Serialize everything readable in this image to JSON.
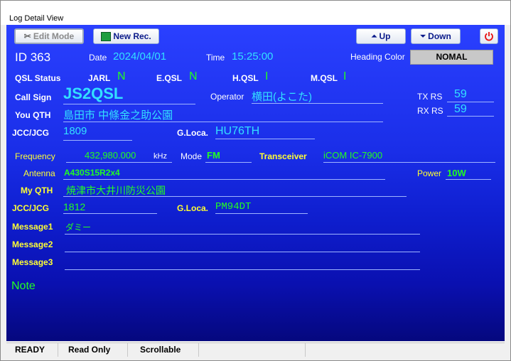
{
  "window": {
    "title": "Log Detail View"
  },
  "toolbar": {
    "edit_mode": "Edit Mode",
    "new_rec": "New Rec.",
    "up": "Up",
    "down": "Down"
  },
  "record": {
    "id": "ID 363",
    "date_label": "Date",
    "date": "2024/04/01",
    "time_label": "Time",
    "time": "15:25:00",
    "heading_color_label": "Heading Color",
    "heading_color": "NOMAL",
    "qsl_status_label": "QSL Status",
    "jarl_label": "JARL",
    "jarl": "N",
    "eqsl_label": "E.QSL",
    "eqsl": "N",
    "hqsl_label": "H.QSL",
    "hqsl": "I",
    "mqsl_label": "M.QSL",
    "mqsl": "I",
    "callsign_label": "Call Sign",
    "callsign": "JS2QSL",
    "operator_label": "Operator",
    "operator": "横田(よこた)",
    "tx_rs_label": "TX RS",
    "tx_rs": "59",
    "rx_rs_label": "RX RS",
    "rx_rs": "59",
    "you_qth_label": "You QTH",
    "you_qth": "島田市 中條金之助公園",
    "jcc_label": "JCC/JCG",
    "jcc": "1809",
    "gloca_label": "G.Loca.",
    "gloca": "HU76TH",
    "frequency_label": "Frequency",
    "frequency": "432,980.000",
    "khz": "kHz",
    "mode_label": "Mode",
    "mode": "FM",
    "transceiver_label": "Transceiver",
    "transceiver": "iCOM IC-7900",
    "antenna_label": "Antenna",
    "antenna": "A430S15R2x4",
    "power_label": "Power",
    "power": "10W",
    "my_qth_label": "My QTH",
    "my_qth": "焼津市大井川防災公園",
    "my_jcc_label": "JCC/JCG",
    "my_jcc": "1812",
    "my_gloca_label": "G.Loca.",
    "my_gloca": "PM94DT",
    "message1_label": "Message1",
    "message1": "ダミー",
    "message2_label": "Message2",
    "message2": "",
    "message3_label": "Message3",
    "message3": "",
    "note_label": "Note"
  },
  "status": {
    "ready": "READY",
    "read_only": "Read Only",
    "scrollable": "Scrollable"
  },
  "colors": {
    "label_yellow": "#ffff33",
    "value_cyan": "#33e0ff",
    "value_green": "#22ff22",
    "power_red": "#e81010"
  }
}
